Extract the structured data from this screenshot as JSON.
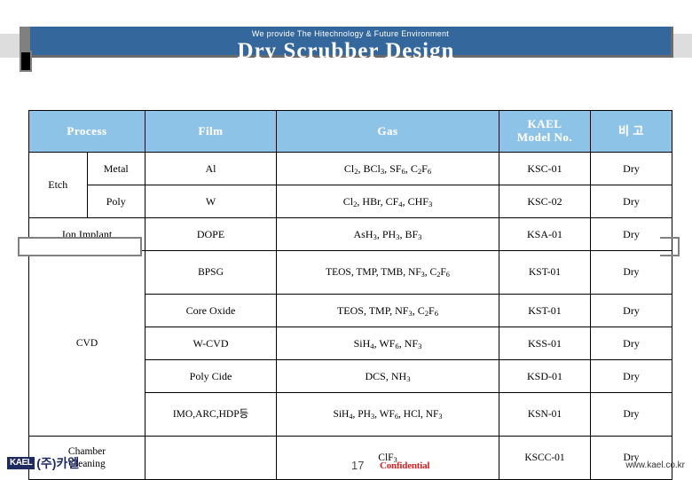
{
  "header": {
    "tagline": "We provide The Hitechnology & Future Environment",
    "slide_title": "Dry Scrubber Design",
    "band_color": "#34679c",
    "strip_color": "#dddddd"
  },
  "table": {
    "header_bg": "#8ec3e8",
    "columns": [
      {
        "key": "process",
        "label": "Process"
      },
      {
        "key": "film",
        "label": "Film"
      },
      {
        "key": "gas",
        "label": "Gas"
      },
      {
        "key": "model",
        "label": "KAEL",
        "label2": "Model No."
      },
      {
        "key": "remark",
        "label": "비  고"
      }
    ],
    "groups": [
      {
        "name": "Etch",
        "label": "Etch"
      },
      {
        "name": "Ion Implant",
        "label": "Ion Implant"
      },
      {
        "name": "CVD",
        "label": "CVD"
      },
      {
        "name": "Chamber Cleaning",
        "label": "Chamber",
        "label2": "Cleaning"
      }
    ],
    "rows": [
      {
        "process": "Etch",
        "sub": "Metal",
        "film": "Al",
        "gas_html": "Cl<sub>2</sub>, BCl<sub>3</sub>, SF<sub>6</sub>, C<sub>2</sub>F<sub>6</sub>",
        "gas_text": "Cl2, BCl3, SF6, C2F6",
        "model": "KSC-01",
        "remark": "Dry"
      },
      {
        "process": "Etch",
        "sub": "Poly",
        "film": "W",
        "gas_html": "Cl<sub>2</sub>, HBr, CF<sub>4</sub>, CHF<sub>3</sub>",
        "gas_text": "Cl2, HBr, CF4, CHF3",
        "model": "KSC-02",
        "remark": "Dry"
      },
      {
        "process": "Ion Implant",
        "sub": "",
        "film": "DOPE",
        "gas_html": "AsH<sub>3</sub>, PH<sub>3</sub>, BF<sub>3</sub>",
        "gas_text": "AsH3, PH3, BF3",
        "model": "KSA-01",
        "remark": "Dry"
      },
      {
        "process": "CVD",
        "sub": "",
        "film": "BPSG",
        "gas_html": "TEOS, TMP, TMB, NF<sub>3</sub>, C<sub>2</sub>F<sub>6</sub>",
        "gas_text": "TEOS, TMP, TMB, NF3, C2F6",
        "model": "KST-01",
        "remark": "Dry"
      },
      {
        "process": "CVD",
        "sub": "",
        "film": "Core Oxide",
        "gas_html": "TEOS, TMP, NF<sub>3</sub>, C<sub>2</sub>F<sub>6</sub>",
        "gas_text": "TEOS, TMP, NF3, C2F6",
        "model": "KST-01",
        "remark": "Dry"
      },
      {
        "process": "CVD",
        "sub": "",
        "film": "W-CVD",
        "gas_html": "SiH<sub>4</sub>, WF<sub>6</sub>, NF<sub>3</sub>",
        "gas_text": "SiH4, WF6, NF3",
        "model": "KSS-01",
        "remark": "Dry"
      },
      {
        "process": "CVD",
        "sub": "",
        "film": "Poly Cide",
        "gas_html": "DCS, NH<sub>3</sub>",
        "gas_text": "DCS, NH3",
        "model": "KSD-01",
        "remark": "Dry"
      },
      {
        "process": "CVD",
        "sub": "",
        "film": "IMO,ARC,HDP등",
        "gas_html": "SiH<sub>4</sub>, PH<sub>3</sub>, WF<sub>6</sub>, HCl, NF<sub>3</sub>",
        "gas_text": "SiH4, PH3, WF6, HCl, NF3",
        "model": "KSN-01",
        "remark": "Dry"
      },
      {
        "process": "Chamber Cleaning",
        "sub": "",
        "film": "",
        "gas_html": "ClF<sub>3</sub>",
        "gas_text": "ClF3",
        "model": "KSCC-01",
        "remark": "Dry"
      }
    ]
  },
  "footer": {
    "logo_mark": "KAEL",
    "logo_text": "(주)카엘",
    "page_number": "17",
    "confidential": "Confidential",
    "url": "www.kael.co.kr",
    "confidential_color": "#d42020"
  }
}
